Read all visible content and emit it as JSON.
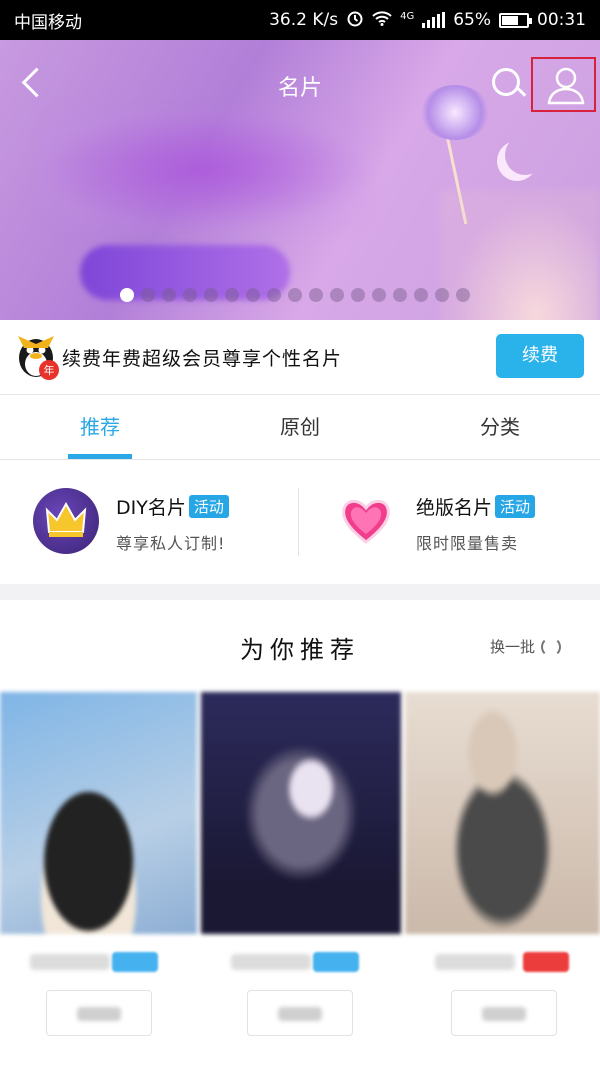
{
  "status_bar": {
    "carrier": "中国移动",
    "speed": "36.2 K/s",
    "network": "4G",
    "battery": "65%",
    "battery_level": 0.65,
    "time": "00:31"
  },
  "header": {
    "title": "名片"
  },
  "banner": {
    "slide_count": 17,
    "active_index": 0
  },
  "vip": {
    "text": "续费年费超级会员尊享个性名片",
    "button_label": "续费"
  },
  "tabs": [
    {
      "label": "推荐",
      "active": true
    },
    {
      "label": "原创",
      "active": false
    },
    {
      "label": "分类",
      "active": false
    }
  ],
  "features": [
    {
      "title": "DIY名片",
      "badge": "活动",
      "subtitle": "尊享私人订制!"
    },
    {
      "title": "绝版名片",
      "badge": "活动",
      "subtitle": "限时限量售卖"
    }
  ],
  "recommend": {
    "title": "为你推荐",
    "refresh_label": "换一批"
  },
  "colors": {
    "accent": "#2aa8e6",
    "highlight_box": "#d8213c",
    "hot_tag": "#ec3d3d"
  }
}
